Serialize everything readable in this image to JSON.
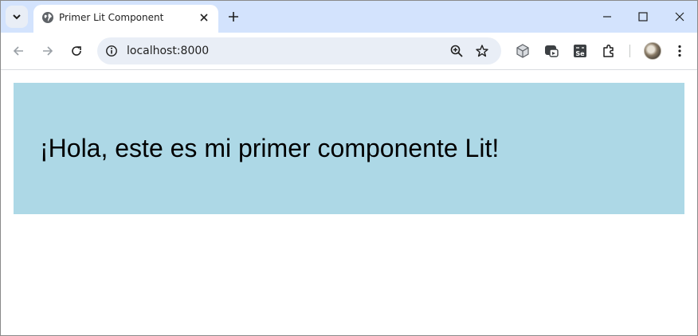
{
  "browser": {
    "tab": {
      "title": "Primer Lit Component"
    },
    "address_bar": {
      "url": "localhost:8000"
    }
  },
  "page": {
    "heading": "¡Hola, este es mi primer componente Lit!"
  },
  "colors": {
    "tabstrip_bg": "#d3e3fd",
    "component_bg": "#add8e6",
    "omnibox_bg": "#e9eef6"
  },
  "icons": [
    "tab-search-icon",
    "globe-icon",
    "close-icon",
    "plus-icon",
    "minimize-icon",
    "maximize-icon",
    "window-close-icon",
    "back-arrow-icon",
    "forward-arrow-icon",
    "reload-icon",
    "site-info-icon",
    "zoom-icon",
    "star-icon",
    "cube-extension-icon",
    "screen-extension-icon",
    "selenium-icon",
    "puzzle-extensions-icon",
    "profile-avatar",
    "kebab-menu-icon"
  ]
}
